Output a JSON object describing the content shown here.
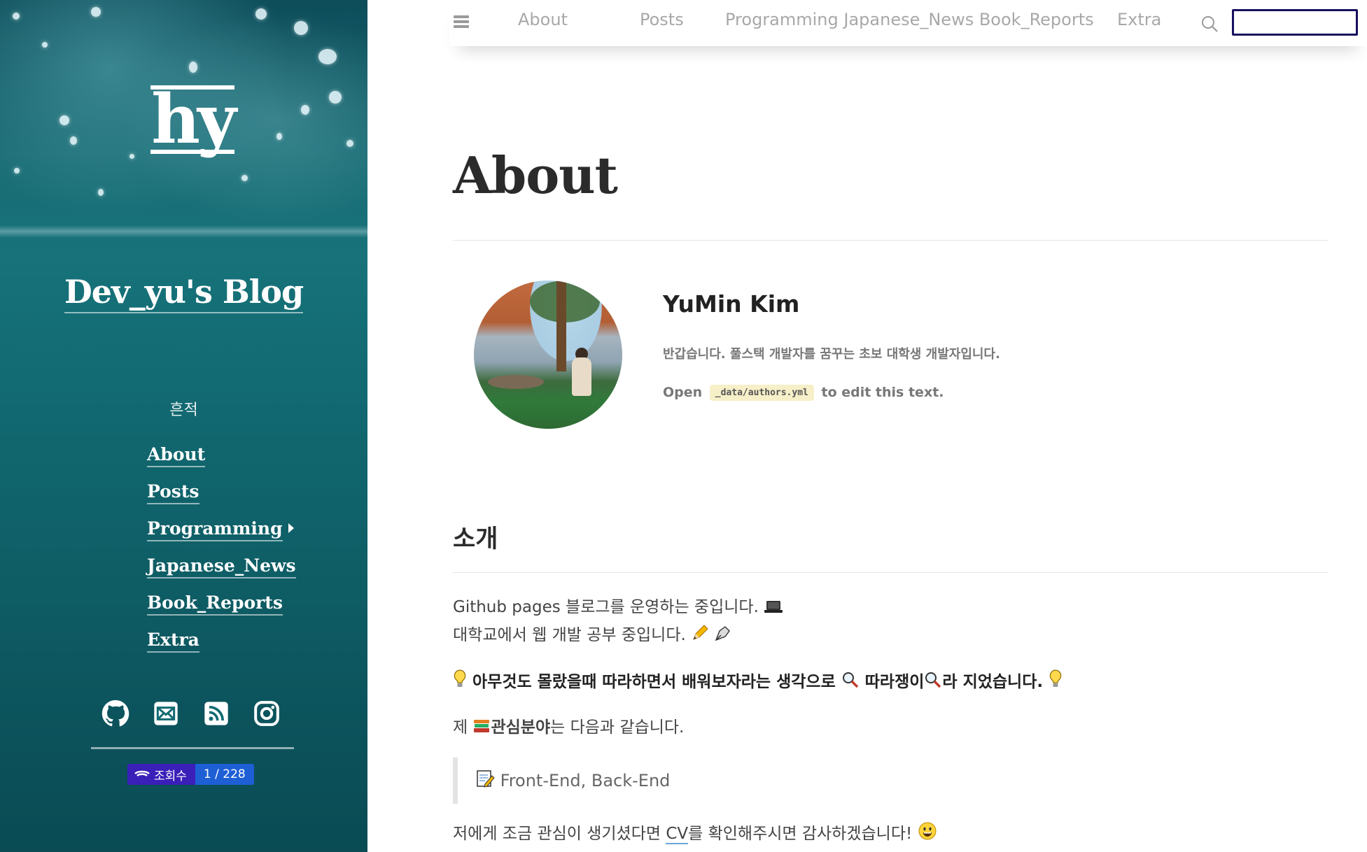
{
  "sidebar": {
    "logo_text": "hy",
    "blog_title": "Dev_yu's Blog",
    "trail_label": "흔적",
    "nav": [
      {
        "label": "About",
        "has_submenu": false
      },
      {
        "label": "Posts",
        "has_submenu": false
      },
      {
        "label": "Programming",
        "has_submenu": true
      },
      {
        "label": "Japanese_News",
        "has_submenu": false
      },
      {
        "label": "Book_Reports",
        "has_submenu": false
      },
      {
        "label": "Extra",
        "has_submenu": false
      }
    ],
    "social_icons": [
      "github-icon",
      "email-icon",
      "rss-icon",
      "instagram-icon"
    ],
    "hits": {
      "label": "조회수",
      "value": "1 / 228"
    }
  },
  "topbar": {
    "menu_icon": "hamburger-icon",
    "links": [
      "About",
      "Posts",
      "Programming Japanese_News Book_Reports",
      "Extra"
    ],
    "search_icon": "search-icon",
    "search_value": ""
  },
  "main": {
    "title": "About",
    "author": {
      "name": "YuMin Kim",
      "bio": "반갑습니다. 풀스택 개발자를 꿈꾸는 초보 대학생 개발자입니다.",
      "open_prefix": "Open",
      "code": "_data/authors.yml",
      "open_suffix": "to edit this text."
    },
    "section_heading": "소개",
    "line1": "Github pages 블로그를 운영하는 중입니다.",
    "line2": "대학교에서 웹 개발 공부 중입니다.",
    "line3_a": "아무것도 몰랐을때 따라하면서 배워보자라는 생각으로",
    "line3_b": "따라쟁이",
    "line3_c": "라 지었습니다.",
    "line4_a": "제",
    "line4_b": "관심분야",
    "line4_c": "는 다음과 같습니다.",
    "quote": "Front-End, Back-End",
    "line5_a": "저에게 조금 관심이 생기셨다면",
    "line5_link": "CV",
    "line5_b": "를 확인해주시면 감사하겠습니다!"
  },
  "colors": {
    "sidebar_teal": "#126a72",
    "search_border": "#17105e",
    "hits_left": "#3a1fb8",
    "hits_right": "#1e5fd6"
  }
}
